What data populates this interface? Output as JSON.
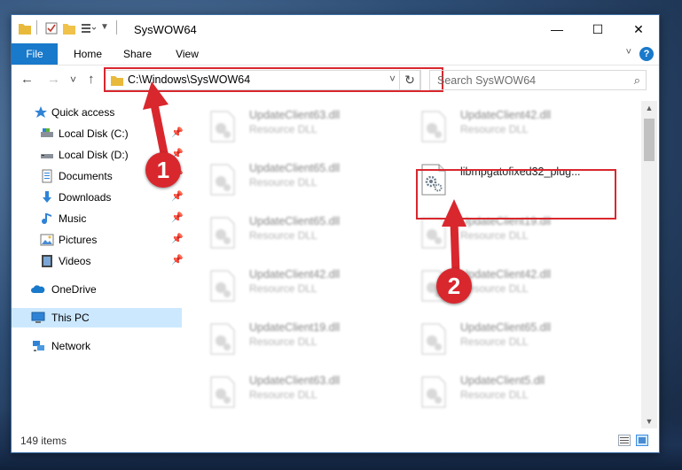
{
  "window": {
    "title": "SysWOW64",
    "controls": {
      "minimize": "—",
      "maximize": "☐",
      "close": "✕"
    }
  },
  "ribbon": {
    "tabs": [
      "File",
      "Home",
      "Share",
      "View"
    ],
    "help": "?"
  },
  "navigation": {
    "back": "←",
    "forward": "→",
    "recent": "˅",
    "up": "↑"
  },
  "address": {
    "path": "C:\\Windows\\SysWOW64"
  },
  "search": {
    "placeholder": "Search SysWOW64"
  },
  "sidebar": {
    "items": [
      {
        "label": "Quick access",
        "icon": "star-icon",
        "pinned": false
      },
      {
        "label": "Local Disk (C:)",
        "icon": "drive-icon",
        "pinned": true
      },
      {
        "label": "Local Disk (D:)",
        "icon": "drive-icon",
        "pinned": true
      },
      {
        "label": "Documents",
        "icon": "documents-icon",
        "pinned": true
      },
      {
        "label": "Downloads",
        "icon": "download-icon",
        "pinned": true
      },
      {
        "label": "Music",
        "icon": "music-icon",
        "pinned": true
      },
      {
        "label": "Pictures",
        "icon": "pictures-icon",
        "pinned": true
      },
      {
        "label": "Videos",
        "icon": "video-icon",
        "pinned": true
      },
      {
        "label": "OneDrive",
        "icon": "cloud-icon",
        "pinned": false
      },
      {
        "label": "This PC",
        "icon": "computer-icon",
        "pinned": false,
        "selected": true
      },
      {
        "label": "Network",
        "icon": "network-icon",
        "pinned": false
      }
    ]
  },
  "files": {
    "left": [
      {
        "name": "UpdateClient63.dll",
        "type": "Resource DLL"
      },
      {
        "name": "UpdateClient65.dll",
        "type": "Resource DLL"
      },
      {
        "name": "UpdateClient65.dll",
        "type": "Resource DLL"
      },
      {
        "name": "UpdateClient42.dll",
        "type": "Resource DLL"
      },
      {
        "name": "UpdateClient19.dll",
        "type": "Resource DLL"
      },
      {
        "name": "UpdateClient63.dll",
        "type": "Resource DLL"
      }
    ],
    "right": [
      {
        "name": "UpdateClient42.dll",
        "type": "Resource DLL"
      },
      {
        "name": "libmpgatofixed32_plug...",
        "type": "",
        "highlighted": true
      },
      {
        "name": "UpdateClient19.dll",
        "type": "Resource DLL"
      },
      {
        "name": "UpdateClient42.dll",
        "type": "Resource DLL"
      },
      {
        "name": "UpdateClient65.dll",
        "type": "Resource DLL"
      },
      {
        "name": "UpdateClient5.dll",
        "type": "Resource DLL"
      }
    ]
  },
  "status": {
    "item_count": "149 items"
  },
  "annotations": {
    "step1": "1",
    "step2": "2",
    "color": "#d9272e"
  }
}
